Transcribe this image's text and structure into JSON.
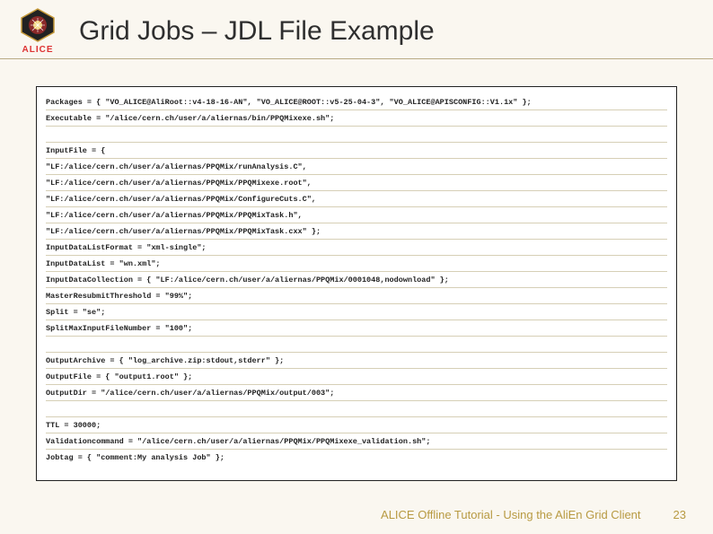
{
  "header": {
    "logo_label": "ALICE",
    "title": "Grid Jobs – JDL File Example"
  },
  "code": {
    "lines": [
      "Packages = { \"VO_ALICE@AliRoot::v4-18-16-AN\", \"VO_ALICE@ROOT::v5-25-04-3\", \"VO_ALICE@APISCONFIG::V1.1x\" };",
      "Executable = \"/alice/cern.ch/user/a/aliernas/bin/PPQMixexe.sh\";",
      " ",
      "InputFile = {",
      "\"LF:/alice/cern.ch/user/a/aliernas/PPQMix/runAnalysis.C\",",
      "\"LF:/alice/cern.ch/user/a/aliernas/PPQMix/PPQMixexe.root\",",
      "\"LF:/alice/cern.ch/user/a/aliernas/PPQMix/ConfigureCuts.C\",",
      "\"LF:/alice/cern.ch/user/a/aliernas/PPQMix/PPQMixTask.h\",",
      "\"LF:/alice/cern.ch/user/a/aliernas/PPQMix/PPQMixTask.cxx\"  };",
      "InputDataListFormat = \"xml-single\";",
      "InputDataList = \"wn.xml\";",
      "InputDataCollection = { \"LF:/alice/cern.ch/user/a/aliernas/PPQMix/0001048,nodownload\" };",
      "MasterResubmitThreshold = \"99%\";",
      "Split = \"se\";",
      "SplitMaxInputFileNumber = \"100\";",
      " ",
      "OutputArchive = { \"log_archive.zip:stdout,stderr\" };",
      "OutputFile =  { \"output1.root\" };",
      "OutputDir = \"/alice/cern.ch/user/a/aliernas/PPQMix/output/003\";",
      " ",
      "TTL = 30000;",
      "Validationcommand = \"/alice/cern.ch/user/a/aliernas/PPQMix/PPQMixexe_validation.sh\";",
      "Jobtag = { \"comment:My analysis Job\" };"
    ]
  },
  "footer": {
    "text": "ALICE Offline Tutorial - Using the AliEn Grid Client",
    "page": "23"
  }
}
